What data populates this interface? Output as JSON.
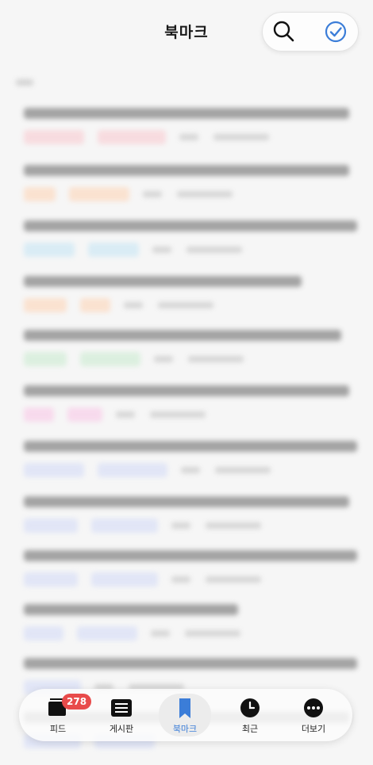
{
  "header": {
    "title": "북마크",
    "search_icon": "search-icon",
    "select_icon": "check-circle-icon",
    "accent": "#3b7dd8"
  },
  "bottom_nav": {
    "items": [
      {
        "label": "피드",
        "icon": "feed-icon",
        "badge": "278"
      },
      {
        "label": "게시판",
        "icon": "board-list-icon"
      },
      {
        "label": "북마크",
        "icon": "bookmark-icon",
        "active": true
      },
      {
        "label": "최근",
        "icon": "clock-icon"
      },
      {
        "label": "더보기",
        "icon": "more-icon"
      }
    ],
    "badge_color": "#e84b4b"
  }
}
